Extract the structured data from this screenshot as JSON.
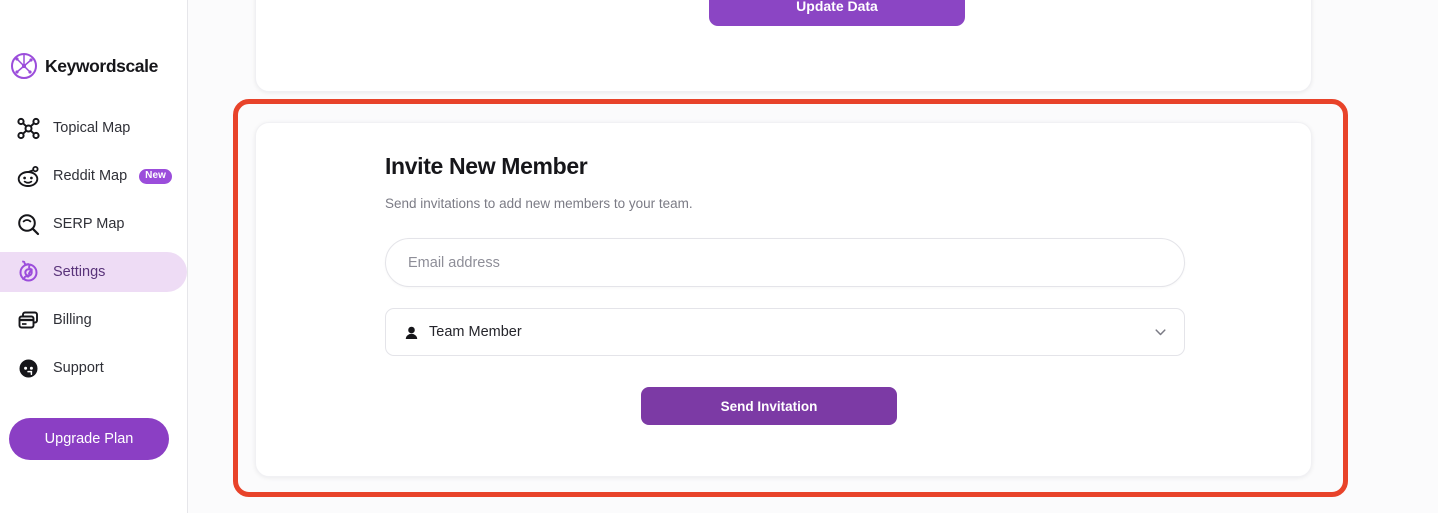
{
  "sidebar": {
    "brand": {
      "name": "Keywordscale",
      "logo_icon": "network-globe-icon"
    },
    "items": [
      {
        "label": "Topical Map",
        "icon": "topical-map-icon",
        "badge": null,
        "active": false
      },
      {
        "label": "Reddit Map",
        "icon": "reddit-icon",
        "badge": "New",
        "active": false
      },
      {
        "label": "SERP Map",
        "icon": "search-icon",
        "badge": null,
        "active": false
      },
      {
        "label": "Settings",
        "icon": "gear-icon",
        "badge": null,
        "active": true
      },
      {
        "label": "Billing",
        "icon": "credit-card-icon",
        "badge": null,
        "active": false
      },
      {
        "label": "Support",
        "icon": "headset-face-icon",
        "badge": null,
        "active": false
      }
    ],
    "upgrade_label": "Upgrade Plan"
  },
  "top_card": {
    "update_button_label": "Update Data"
  },
  "invite": {
    "title": "Invite New Member",
    "subtitle": "Send invitations to add new members to your team.",
    "email_placeholder": "Email address",
    "email_value": "",
    "role_selected": "Team Member",
    "role_icon": "person-icon",
    "chevron_icon": "chevron-down-icon",
    "submit_label": "Send Invitation"
  },
  "colors": {
    "accent_purple": "#8b3fc4",
    "button_purple_dark": "#7c3aa5",
    "button_purple_light": "#8b45c4",
    "active_nav_bg": "#eedcf5",
    "badge_purple": "#9b4ddb",
    "highlight_orange": "#e8432a",
    "page_bg": "#fbfbfc"
  }
}
